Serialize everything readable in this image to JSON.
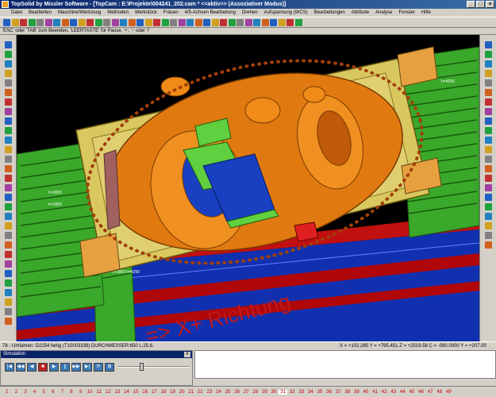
{
  "window": {
    "title": "TopSolid by Missler Software - [TopCam : E:\\Projekte\\004241_202.cam * <<aktiv>> (Assoziativer Modus)]"
  },
  "menu": [
    "Datei",
    "Bearbeiten",
    "Maschine/Werkzeug",
    "Methoden",
    "Werkstück",
    "Fräsen",
    "4/5-Achsen Bearbeitung",
    "Drehen",
    "Aufspannung (WCS)",
    "Bearbeitungen",
    "Attribute",
    "Analyse",
    "Fenster",
    "Hilfe"
  ],
  "hint": "'ESC' oder 'TAB' zum Beenden, 'LEERTASTE' für Pause, '+', '-' oder '/'",
  "viewport": {
    "annotation": "=> X+ Richtung",
    "plate_labels": [
      "h=3000",
      "h=2000",
      "h=4250",
      "h=3000 h=4250"
    ]
  },
  "status": {
    "left": "78 - Umfahren: D2254 fertig   (T10003339)  DURCHMESSER:650  L:25.6.",
    "coords": "X = +102.285   Y = +795.451   Z = +2519.58   C = -090.0000   Y = +207.00"
  },
  "simulation": {
    "title": "Simulation",
    "close": "X",
    "buttons": [
      "|◀",
      "◀◀",
      "◀",
      "■",
      "▶",
      "||",
      "▶▶",
      "▶|",
      "⟳",
      "⊞"
    ]
  },
  "page_numbers": [
    "1",
    "2",
    "3",
    "4",
    "5",
    "6",
    "7",
    "8",
    "9",
    "10",
    "11",
    "12",
    "13",
    "14",
    "15",
    "16",
    "17",
    "18",
    "19",
    "20",
    "21",
    "22",
    "23",
    "24",
    "25",
    "26",
    "27",
    "28",
    "29",
    "30",
    "31",
    "32",
    "33",
    "34",
    "35",
    "36",
    "37",
    "38",
    "39",
    "40",
    "41",
    "42",
    "43",
    "44",
    "45",
    "46",
    "47",
    "48",
    "49"
  ],
  "colors": {
    "machine_green": "#3aa82a",
    "part_orange": "#e07a10",
    "table_blue": "#1030b0",
    "table_red": "#c01010",
    "tool_green": "#60d040",
    "tool_blue": "#1840c0",
    "annotation_red": "#c01818"
  }
}
